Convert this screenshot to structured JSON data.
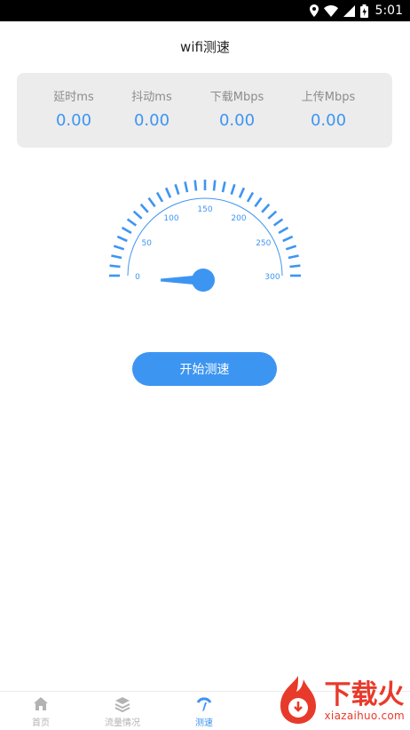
{
  "status_bar": {
    "time": "5:01"
  },
  "page": {
    "title": "wifi测速"
  },
  "stats": [
    {
      "label": "延时ms",
      "value": "0.00"
    },
    {
      "label": "抖动ms",
      "value": "0.00"
    },
    {
      "label": "下载Mbps",
      "value": "0.00"
    },
    {
      "label": "上传Mbps",
      "value": "0.00"
    }
  ],
  "gauge": {
    "scale_labels": [
      "0",
      "50",
      "100",
      "150",
      "200",
      "250",
      "300"
    ],
    "min": 0,
    "max": 300,
    "current_value": 0,
    "accent_color": "#3d95f2"
  },
  "start_button": {
    "label": "开始测速"
  },
  "bottom_nav": [
    {
      "label": "首页",
      "icon": "home-icon",
      "active": false
    },
    {
      "label": "流量情况",
      "icon": "layers-icon",
      "active": false
    },
    {
      "label": "测速",
      "icon": "speed-icon",
      "active": true
    }
  ],
  "watermark": {
    "brand": "下载火",
    "url": "xiazaihuo.com"
  },
  "colors": {
    "accent": "#3d95f2",
    "card_bg": "#ececec",
    "watermark": "#e83a2a"
  }
}
